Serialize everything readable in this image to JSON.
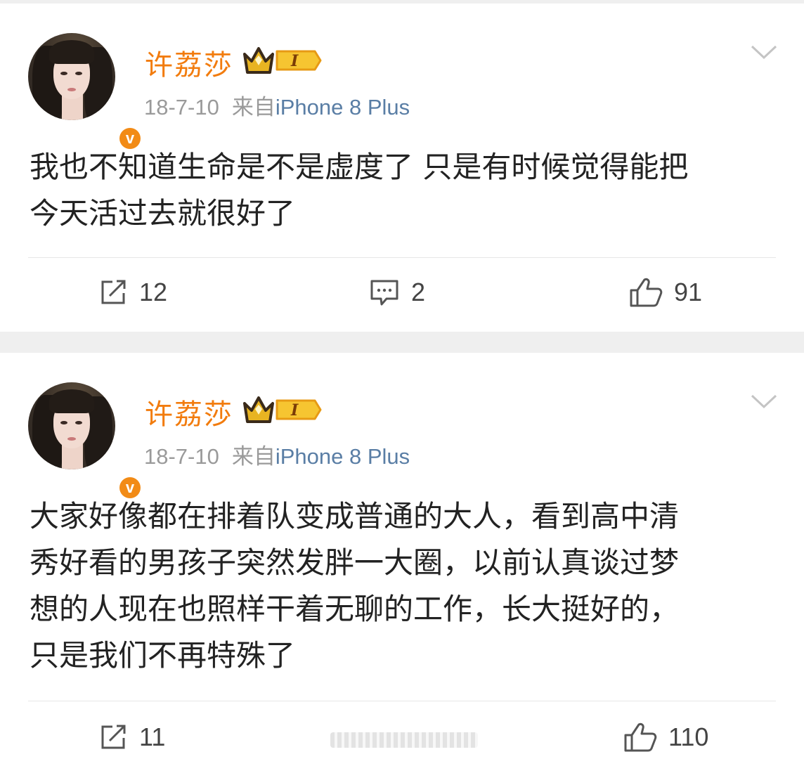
{
  "posts": [
    {
      "username": "许荔莎",
      "badge_level": "I",
      "date": "18-7-10",
      "from_label": "来自",
      "device": "iPhone 8 Plus",
      "text": "我也不知道生命是不是虚度了 只是有时候觉得能把\n今天活过去就很好了",
      "repost_count": "12",
      "comment_count": "2",
      "like_count": "91"
    },
    {
      "username": "许荔莎",
      "badge_level": "I",
      "date": "18-7-10",
      "from_label": "来自",
      "device": "iPhone 8 Plus",
      "text": "大家好像都在排着队变成普通的大人，看到高中清\n秀好看的男孩子突然发胖一大圈，以前认真谈过梦\n想的人现在也照样干着无聊的工作，长大挺好的，\n只是我们不再特殊了",
      "repost_count": "11",
      "like_count": "110"
    }
  ],
  "colors": {
    "username": "#f27c0e",
    "device_link": "#5a7ea5",
    "meta": "#9a9a9a",
    "verified": "#f28b16",
    "separator": "#efefef"
  },
  "icons": {
    "repost": "repost-icon",
    "comment": "comment-icon",
    "like": "thumbs-up-icon",
    "more": "chevron-down-icon",
    "verified": "verified-v-icon",
    "vip": "crown-badge-icon"
  },
  "verified_mark": "v"
}
